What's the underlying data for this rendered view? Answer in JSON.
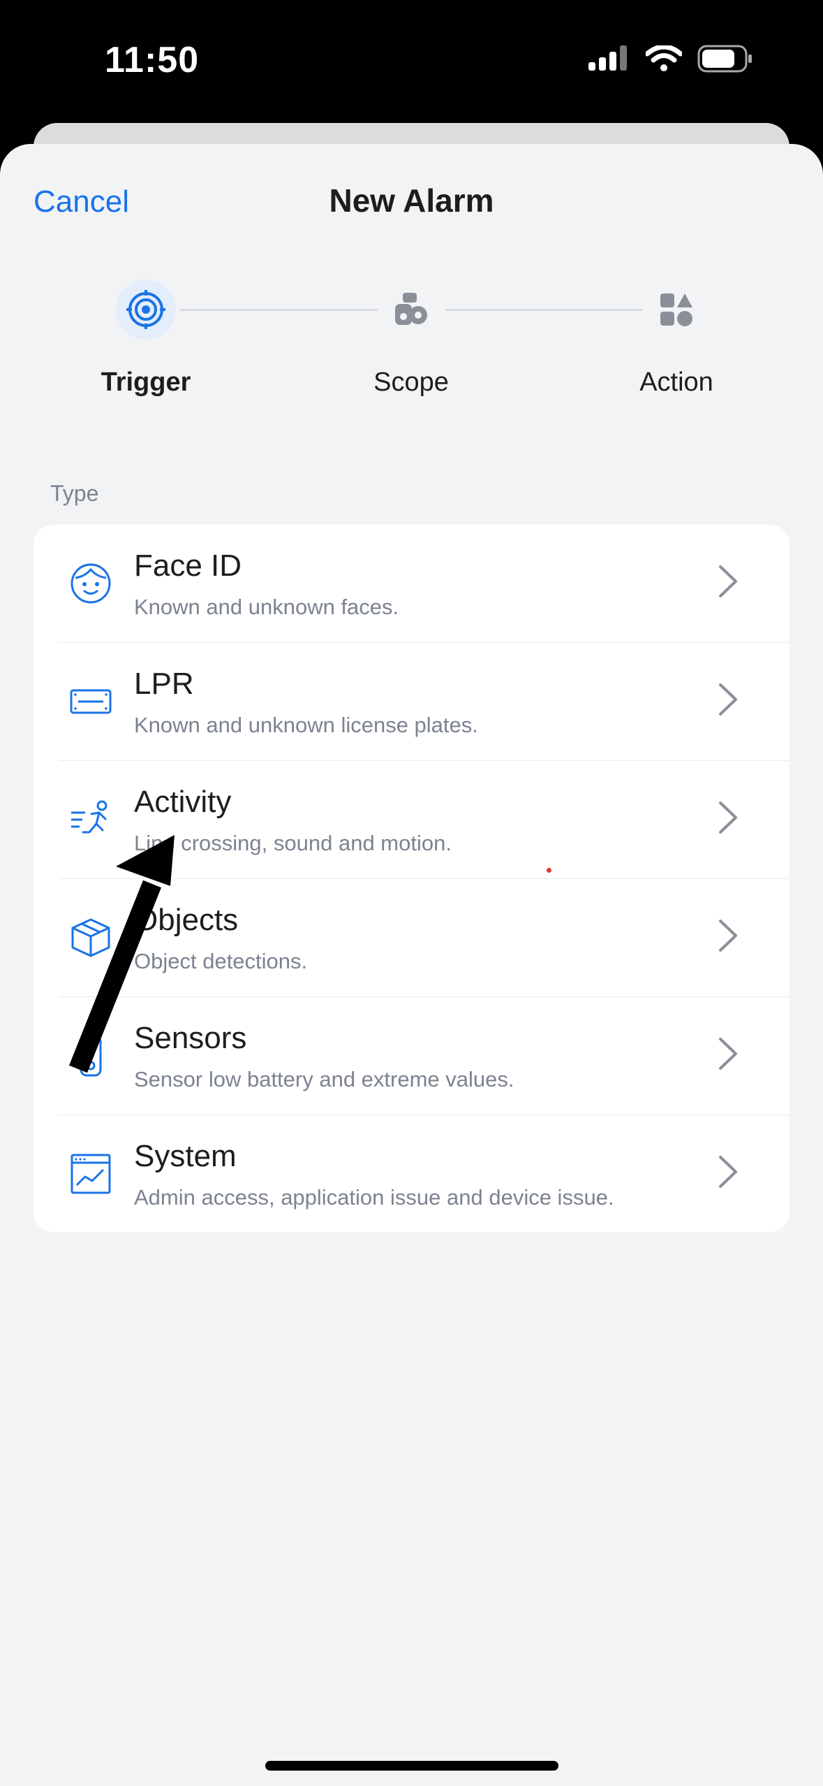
{
  "status_bar": {
    "time": "11:50"
  },
  "header": {
    "cancel_label": "Cancel",
    "title": "New Alarm"
  },
  "stepper": {
    "steps": [
      {
        "label": "Trigger",
        "icon": "target-icon",
        "active": true
      },
      {
        "label": "Scope",
        "icon": "scope-icon",
        "active": false
      },
      {
        "label": "Action",
        "icon": "shapes-icon",
        "active": false
      }
    ]
  },
  "section": {
    "label": "Type"
  },
  "types": [
    {
      "name": "Face ID",
      "description": "Known and unknown faces.",
      "icon": "face-icon"
    },
    {
      "name": "LPR",
      "description": "Known and unknown license plates.",
      "icon": "license-plate-icon"
    },
    {
      "name": "Activity",
      "description": "Line crossing, sound and motion.",
      "icon": "running-person-icon"
    },
    {
      "name": "Objects",
      "description": "Object detections.",
      "icon": "box-icon"
    },
    {
      "name": "Sensors",
      "description": "Sensor low battery and extreme values.",
      "icon": "sensor-icon"
    },
    {
      "name": "System",
      "description": "Admin access, application issue and device issue.",
      "icon": "system-chart-icon"
    }
  ],
  "colors": {
    "accent": "#1a73e8",
    "background": "#f2f3f5",
    "text_primary": "#1d1d1f",
    "text_secondary": "#7c8390"
  }
}
